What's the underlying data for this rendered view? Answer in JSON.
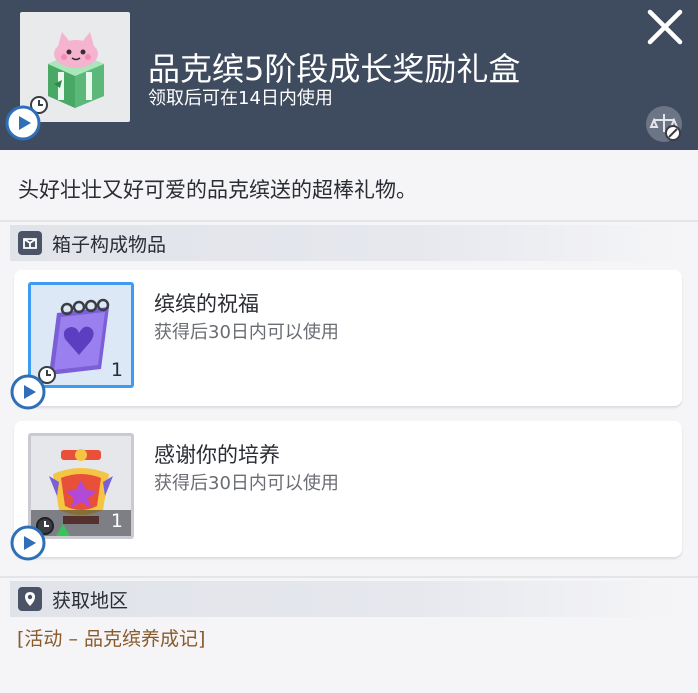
{
  "header": {
    "title": "品克缤5阶段成长奖励礼盒",
    "subtitle": "领取后可在14日内使用",
    "close_icon": "close-icon",
    "trade_icon": "trade-restricted-icon"
  },
  "description": "头好壮壮又好可爱的品克缤送的超棒礼物。",
  "box_section": {
    "title": "箱子构成物品",
    "icon": "box-icon",
    "items": [
      {
        "name": "缤缤的祝福",
        "note": "获得后30日内可以使用",
        "quantity": "1",
        "selected": true
      },
      {
        "name": "感谢你的培养",
        "note": "获得后30日内可以使用",
        "quantity": "1",
        "selected": false
      }
    ]
  },
  "location_section": {
    "title": "获取地区",
    "icon": "map-pin-icon",
    "link": "[活动 – 品克缤养成记]"
  },
  "colors": {
    "header_bg": "#3f4b5e",
    "selected_border": "#3d9bf0",
    "link_color": "#8a5a2b"
  }
}
